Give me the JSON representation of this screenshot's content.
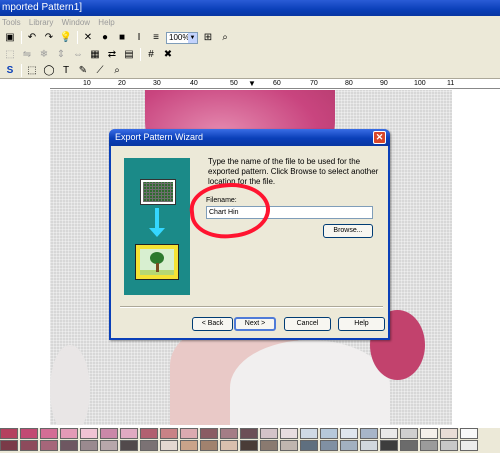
{
  "window": {
    "title": "mported Pattern1]"
  },
  "menu": {
    "items": [
      "Tools",
      "Library",
      "Window",
      "Help"
    ]
  },
  "toolbar": {
    "zoom_value": "100%"
  },
  "ruler": {
    "labels": [
      "10",
      "20",
      "30",
      "40",
      "50",
      "60",
      "70",
      "80",
      "90",
      "100",
      "11"
    ]
  },
  "dialog": {
    "title": "Export Pattern Wizard",
    "instructions": "Type the name of the file to be used for the exported pattern.  Click Browse to select another location for the file.",
    "filename_label": "Filename:",
    "filename_value": "Chart Hin",
    "browse_label": "Browse...",
    "back_label": "< Back",
    "next_label": "Next >",
    "cancel_label": "Cancel",
    "help_label": "Help",
    "annotation_color": "#ff1430"
  },
  "palette": {
    "row1": [
      "#b4405f",
      "#c24a73",
      "#d36d95",
      "#e39ab7",
      "#f0c3d4",
      "#ca88a8",
      "#e0aac2",
      "#b16070",
      "#c98286",
      "#dbaab0",
      "#8a5c63",
      "#a47d86",
      "#6c4f57",
      "#d3c3c8",
      "#e7dde0",
      "#cfd9e5",
      "#b6c8da",
      "#dfe6ee",
      "#a7b5c8",
      "#e9e9e9",
      "#cfcfcf",
      "#f5f0ea",
      "#e8dcd6",
      "#f9f9f9"
    ],
    "row2": [
      "#7a3a48",
      "#8d4b5c",
      "#a6667a",
      "#6e5761",
      "#9a8a8f",
      "#b7a7ab",
      "#524a4c",
      "#7b7274",
      "#e3d7d1",
      "#caa38a",
      "#a1826e",
      "#d9bfae",
      "#4a3c37",
      "#8a7a70",
      "#bfb5af",
      "#5f6f7f",
      "#8090a3",
      "#a2b0c0",
      "#d1d7de",
      "#3d3d3d",
      "#6b6b6b",
      "#9b9b9b",
      "#c8c8c8",
      "#ececec"
    ]
  }
}
